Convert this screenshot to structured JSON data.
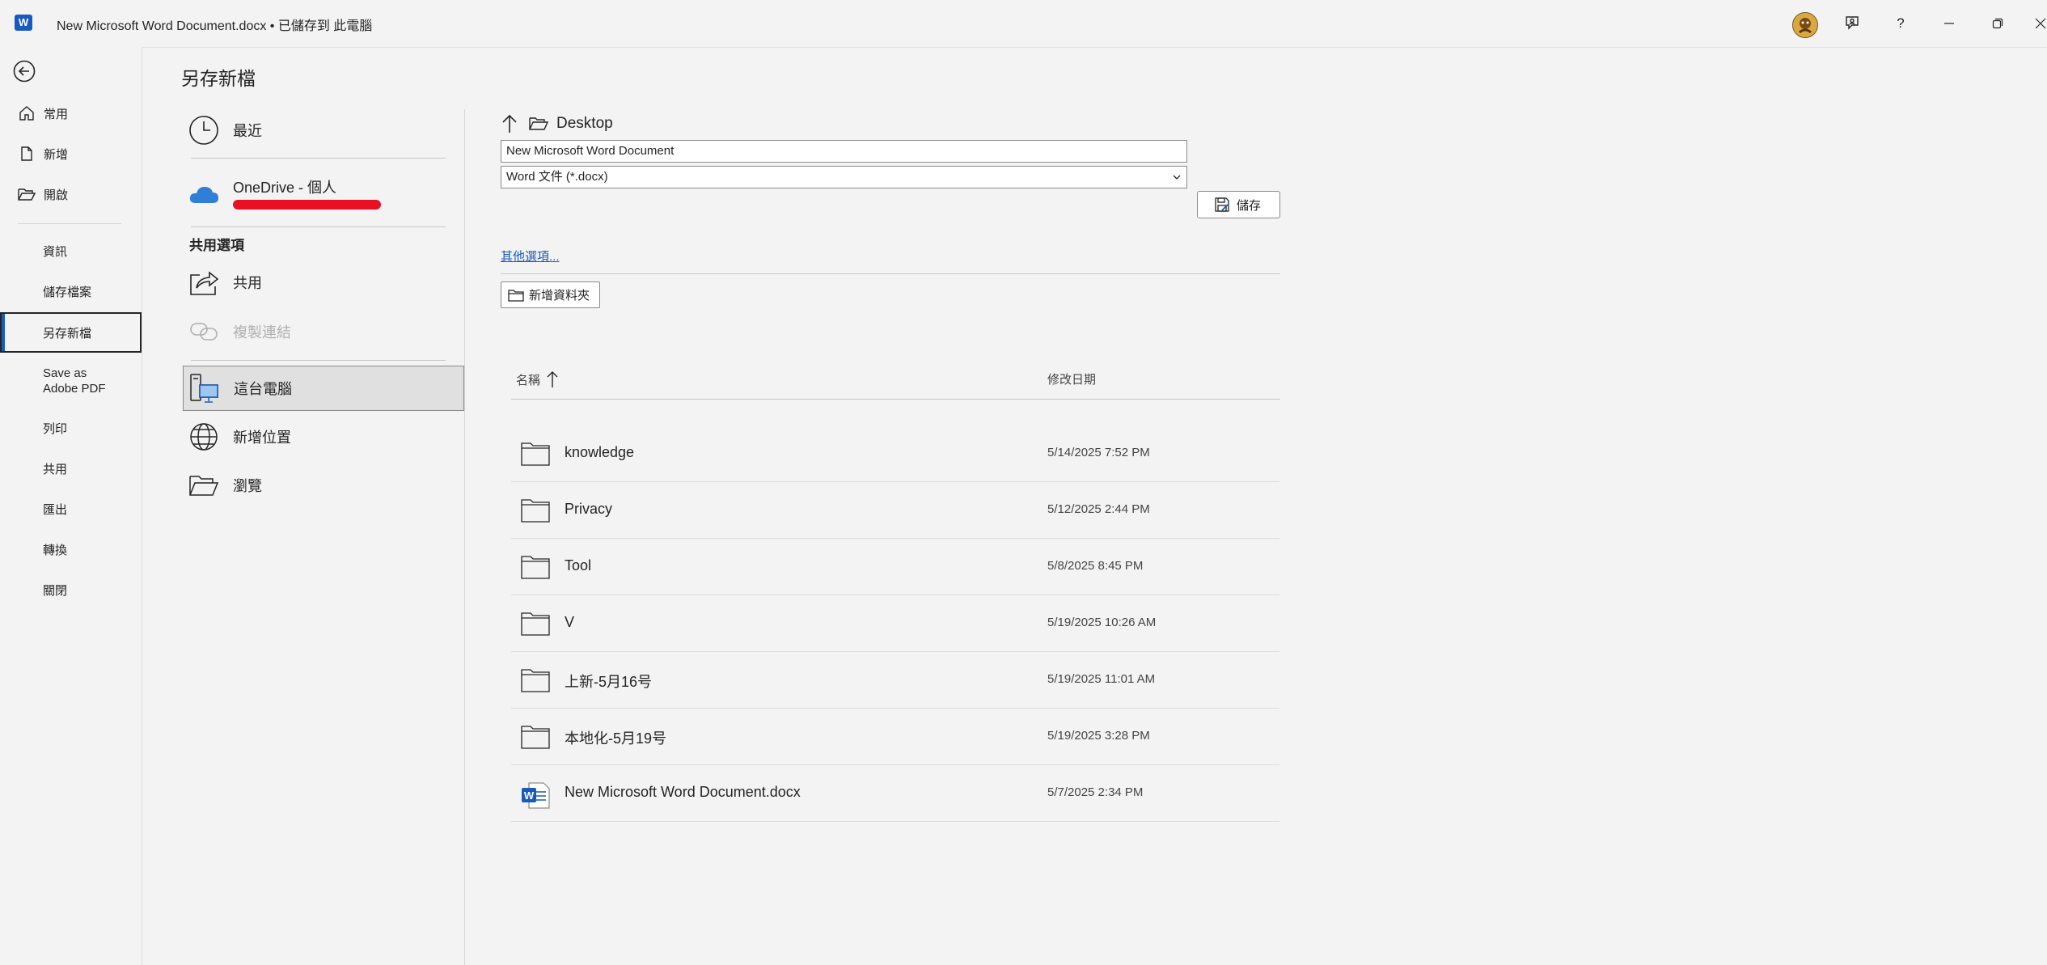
{
  "title_bar": {
    "app_icon_letter": "W",
    "document_title": "New Microsoft Word Document.docx • 已儲存到 此電腦",
    "icons": [
      "avatar",
      "coauthor-icon",
      "help-icon",
      "minimize-icon",
      "restore-icon",
      "close-icon"
    ],
    "help_glyph": "?"
  },
  "nav": {
    "back_icon": "back-arrow-icon",
    "primary": [
      {
        "label": "常用",
        "icon": "home-icon"
      },
      {
        "label": "新增",
        "icon": "new-document-icon"
      },
      {
        "label": "開啟",
        "icon": "open-folder-icon"
      }
    ],
    "secondary": [
      {
        "label": "資訊"
      },
      {
        "label": "儲存檔案"
      },
      {
        "label": "另存新檔",
        "selected": true
      },
      {
        "label": "Save as\nAdobe PDF",
        "line1": "Save as",
        "line2": "Adobe PDF"
      },
      {
        "label": "列印"
      },
      {
        "label": "共用"
      },
      {
        "label": "匯出"
      },
      {
        "label": "轉換"
      },
      {
        "label": "關閉"
      }
    ]
  },
  "page": {
    "title": "另存新檔",
    "locations": {
      "recent": "最近",
      "onedrive": "OneDrive - 個人",
      "shared_section": "共用選項",
      "share": "共用",
      "copy_link": "複製連結",
      "this_pc": "這台電腦",
      "add_place": "新增位置",
      "browse": "瀏覽"
    }
  },
  "save_panel": {
    "path": "Desktop",
    "filename": "New Microsoft Word Document",
    "filetype": "Word 文件 (*.docx)",
    "save_label": "儲存",
    "more_options": "其他選項...",
    "new_folder": "新增資料夾",
    "columns": {
      "name": "名稱",
      "modified": "修改日期"
    },
    "files": [
      {
        "name": "knowledge",
        "date": "5/14/2025 7:52 PM",
        "type": "folder"
      },
      {
        "name": "Privacy",
        "date": "5/12/2025 2:44 PM",
        "type": "folder"
      },
      {
        "name": "Tool",
        "date": "5/8/2025 8:45 PM",
        "type": "folder"
      },
      {
        "name": "V",
        "date": "5/19/2025 10:26 AM",
        "type": "folder"
      },
      {
        "name": "上新-5月16号",
        "date": "5/19/2025 11:01 AM",
        "type": "folder"
      },
      {
        "name": "本地化-5月19号",
        "date": "5/19/2025 3:28 PM",
        "type": "folder"
      },
      {
        "name": "New Microsoft Word Document.docx",
        "date": "5/7/2025 2:34 PM",
        "type": "word"
      }
    ]
  },
  "colors": {
    "accent": "#185abd",
    "background": "#f3f3f3",
    "redaction": "#e81123",
    "onedrive": "#2f7fd6"
  }
}
